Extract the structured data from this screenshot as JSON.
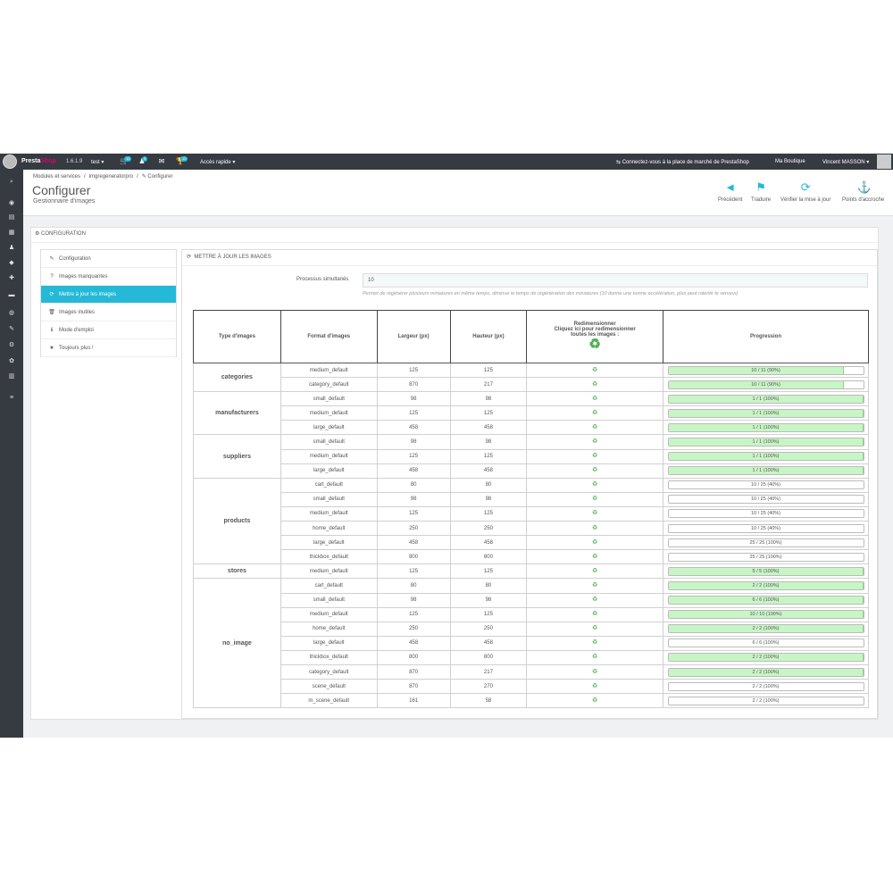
{
  "topbar": {
    "brand_a": "Presta",
    "brand_b": "Shop",
    "version": "1.6.1.9",
    "shop": "test ▾",
    "badges": [
      "10",
      "5",
      "10"
    ],
    "quick_access": "Accès rapide ▾",
    "marketplace": "Connectez-vous à la place de marché de PrestaShop",
    "my_shop": "Ma Boutique",
    "user": "Vincent MASSON ▾"
  },
  "header": {
    "breadcrumb": [
      "Modules et services",
      "/",
      "imgregeneratorpro",
      "/",
      "✎ Configurer"
    ],
    "title": "Configurer",
    "subtitle": "Gestionnaire d'images",
    "toolbar": [
      {
        "label": "Précédent",
        "icon": "back-icon",
        "glyph": "◄"
      },
      {
        "label": "Traduire",
        "icon": "flag-icon",
        "glyph": "⚑"
      },
      {
        "label": "Vérifier la mise à jour",
        "icon": "refresh-icon",
        "glyph": "⟳"
      },
      {
        "label": "Points d'accroche",
        "icon": "anchor-icon",
        "glyph": "⚓"
      }
    ]
  },
  "panel": {
    "title": "CONFIGURATION"
  },
  "menu": [
    {
      "label": "Configuration",
      "icon": "pencil-icon",
      "glyph": "✎",
      "active": false
    },
    {
      "label": "Images manquantes",
      "icon": "question-icon",
      "glyph": "?",
      "active": false
    },
    {
      "label": "Mettre à jour les images",
      "icon": "refresh-icon",
      "glyph": "⟳",
      "active": true
    },
    {
      "label": "Images inutiles",
      "icon": "trash-icon",
      "glyph": "🗑",
      "active": false
    },
    {
      "label": "Mode d'emploi",
      "icon": "info-icon",
      "glyph": "ℹ",
      "active": false
    },
    {
      "label": "Toujours plus !",
      "icon": "star-icon",
      "glyph": "★",
      "active": false
    }
  ],
  "content": {
    "title": "METTRE À JOUR LES IMAGES",
    "process_label": "Processus simultanés",
    "process_value": "10",
    "process_help": "Permet de régénérer plusieurs miniatures en même temps, diminue le temps de régénération des miniatures (10 donne une bonne accélération, plus peut ralentir le serveur)"
  },
  "table": {
    "headers": {
      "type": "Type d'images",
      "format": "Format d'images",
      "width": "Largeur (px)",
      "height": "Hauteur (px)",
      "resize_1": "Redimensionner",
      "resize_2": "Cliquez ici pour redimensionner",
      "resize_3": "toutes les images :",
      "progress": "Progression"
    },
    "groups": [
      {
        "type": "categories",
        "rows": [
          {
            "format": "medium_default",
            "width": "125",
            "height": "125",
            "progress": "10 / 11 (90%)",
            "fraction": 0.9
          },
          {
            "format": "category_default",
            "width": "870",
            "height": "217",
            "progress": "10 / 11 (90%)",
            "fraction": 0.9
          }
        ]
      },
      {
        "type": "manufacturers",
        "rows": [
          {
            "format": "small_default",
            "width": "98",
            "height": "98",
            "progress": "1 / 1 (100%)",
            "fraction": 1
          },
          {
            "format": "medium_default",
            "width": "125",
            "height": "125",
            "progress": "1 / 1 (100%)",
            "fraction": 1
          },
          {
            "format": "large_default",
            "width": "458",
            "height": "458",
            "progress": "1 / 1 (100%)",
            "fraction": 1
          }
        ]
      },
      {
        "type": "suppliers",
        "rows": [
          {
            "format": "small_default",
            "width": "98",
            "height": "98",
            "progress": "1 / 1 (100%)",
            "fraction": 1
          },
          {
            "format": "medium_default",
            "width": "125",
            "height": "125",
            "progress": "1 / 1 (100%)",
            "fraction": 1
          },
          {
            "format": "large_default",
            "width": "458",
            "height": "458",
            "progress": "1 / 1 (100%)",
            "fraction": 1
          }
        ]
      },
      {
        "type": "products",
        "rows": [
          {
            "format": "cart_default",
            "width": "80",
            "height": "80",
            "progress": "10 / 25 (40%)",
            "fraction": 0
          },
          {
            "format": "small_default",
            "width": "98",
            "height": "98",
            "progress": "10 / 25 (40%)",
            "fraction": 0
          },
          {
            "format": "medium_default",
            "width": "125",
            "height": "125",
            "progress": "10 / 25 (40%)",
            "fraction": 0
          },
          {
            "format": "home_default",
            "width": "250",
            "height": "250",
            "progress": "10 / 25 (40%)",
            "fraction": 0
          },
          {
            "format": "large_default",
            "width": "458",
            "height": "458",
            "progress": "25 / 25 (100%)",
            "fraction": 0
          },
          {
            "format": "thickbox_default",
            "width": "800",
            "height": "800",
            "progress": "25 / 25 (100%)",
            "fraction": 0
          }
        ]
      },
      {
        "type": "stores",
        "rows": [
          {
            "format": "medium_default",
            "width": "125",
            "height": "125",
            "progress": "5 / 5 (100%)",
            "fraction": 1
          }
        ]
      },
      {
        "type": "no_image",
        "rows": [
          {
            "format": "cart_default",
            "width": "80",
            "height": "80",
            "progress": "2 / 2 (100%)",
            "fraction": 1
          },
          {
            "format": "small_default",
            "width": "98",
            "height": "98",
            "progress": "6 / 6 (100%)",
            "fraction": 1
          },
          {
            "format": "medium_default",
            "width": "125",
            "height": "125",
            "progress": "10 / 10 (100%)",
            "fraction": 1
          },
          {
            "format": "home_default",
            "width": "250",
            "height": "250",
            "progress": "2 / 2 (100%)",
            "fraction": 1
          },
          {
            "format": "large_default",
            "width": "458",
            "height": "458",
            "progress": "6 / 6 (100%)",
            "fraction": 0
          },
          {
            "format": "thickbox_default",
            "width": "800",
            "height": "800",
            "progress": "2 / 2 (100%)",
            "fraction": 1
          },
          {
            "format": "category_default",
            "width": "870",
            "height": "217",
            "progress": "2 / 2 (100%)",
            "fraction": 1
          },
          {
            "format": "scene_default",
            "width": "870",
            "height": "270",
            "progress": "2 / 2 (100%)",
            "fraction": 0
          },
          {
            "format": "m_scene_default",
            "width": "161",
            "height": "58",
            "progress": "2 / 2 (100%)",
            "fraction": 0
          }
        ]
      }
    ]
  },
  "sidebar_icons": [
    "search-icon",
    "dashboard-icon",
    "catalog-icon",
    "orders-icon",
    "customers-icon",
    "price-rules-icon",
    "modules-icon",
    "shipping-icon",
    "localization-icon",
    "preferences-icon",
    "advanced-icon",
    "administration-icon",
    "stats-icon",
    "menu-icon"
  ],
  "sidebar_glyphs": [
    "⌕",
    "◉",
    "▤",
    "▦",
    "♟",
    "◆",
    "✚",
    "▬",
    "◍",
    "✎",
    "⚙",
    "✿",
    "▥",
    "≡"
  ],
  "colors": {
    "accent": "#25b9d7",
    "progress_fill": "#c8f5c5",
    "topbar": "#363a41"
  }
}
